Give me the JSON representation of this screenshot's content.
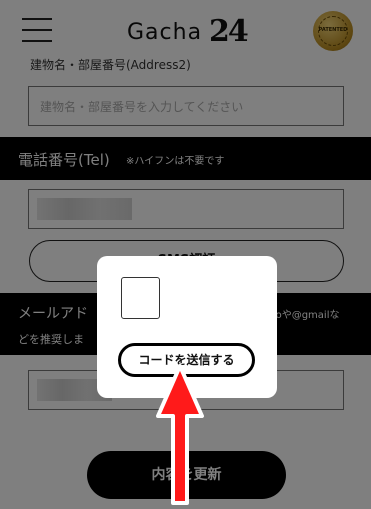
{
  "header": {
    "logo_text": "Gacha",
    "logo_number": "24",
    "badge_text": "PATENTED"
  },
  "address": {
    "label_partial": "建物名・部屋番号(Address2)",
    "placeholder": "建物名・部屋番号を入力してください"
  },
  "tel_section": {
    "title": "電話番号(Tel)",
    "note": "※ハイフンは不要です"
  },
  "sms_button": {
    "label": "SMS認証"
  },
  "mail_section": {
    "title": "メールアド",
    "right_text": "ahooや@gmailな",
    "line2": "どを推奨しま"
  },
  "email_input": {
    "fragment": "e"
  },
  "update_button": {
    "label": "内容を更新"
  },
  "modal": {
    "send_button_label": "コードを送信する"
  },
  "colors": {
    "arrow": "#ff1a1a",
    "overlay": "rgba(0,0,0,0.5)"
  }
}
